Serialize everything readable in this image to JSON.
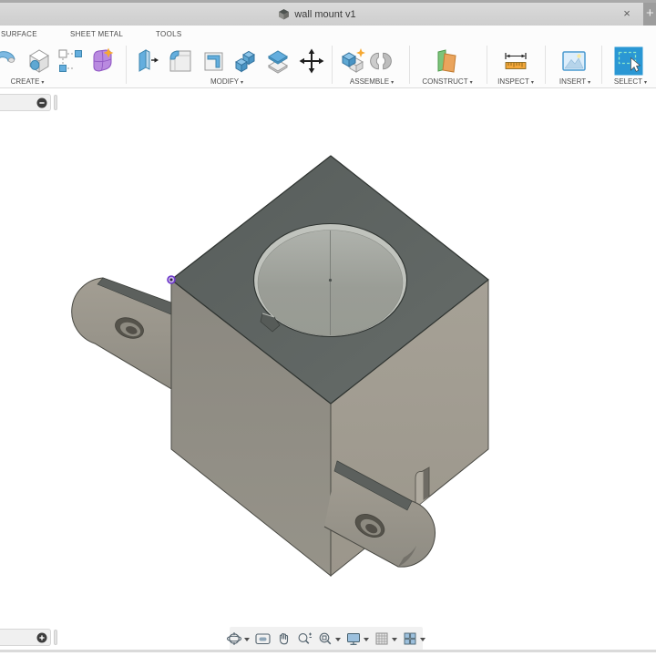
{
  "titlebar": {
    "title": "wall mount v1",
    "close_glyph": "×",
    "new_tab_glyph": "+"
  },
  "ribbon": {
    "caret": "▾",
    "tabs": [
      {
        "label": "SURFACE"
      },
      {
        "label": "SHEET METAL"
      },
      {
        "label": "TOOLS"
      }
    ],
    "groups": [
      {
        "label": "CREATE",
        "icons": [
          "sweep-icon",
          "hole-icon",
          "sketch-pattern-icon",
          "create-form-icon"
        ]
      },
      {
        "label": "MODIFY",
        "icons": [
          "press-pull-icon",
          "fillet-icon",
          "shell-icon",
          "combine-icon",
          "offset-face-icon",
          "move-icon"
        ]
      },
      {
        "label": "ASSEMBLE",
        "icons": [
          "new-component-icon",
          "joint-icon"
        ]
      },
      {
        "label": "CONSTRUCT",
        "icons": [
          "construction-plane-icon"
        ]
      },
      {
        "label": "INSPECT",
        "icons": [
          "measure-icon"
        ]
      },
      {
        "label": "INSERT",
        "icons": [
          "insert-image-icon"
        ]
      },
      {
        "label": "SELECT",
        "icons": [
          "select-icon"
        ]
      }
    ]
  },
  "navbar": {
    "items": [
      "orbit",
      "look-at",
      "pan",
      "zoom",
      "fit",
      "display-settings",
      "grid-and-snaps",
      "viewports"
    ]
  },
  "panels": {
    "browser_toggle_glyph": "−",
    "timeline_toggle_glyph": "+"
  },
  "model": {
    "name": "wall mount v1",
    "colors": {
      "top_face": "#5c6260",
      "left_face": "#8f8c84",
      "right_face": "#a29d92",
      "bore": "#9a9d97",
      "bore_rim": "#c0c3bd",
      "ear_hole": "#55534b",
      "selection_marker": "#6b35c8"
    }
  }
}
